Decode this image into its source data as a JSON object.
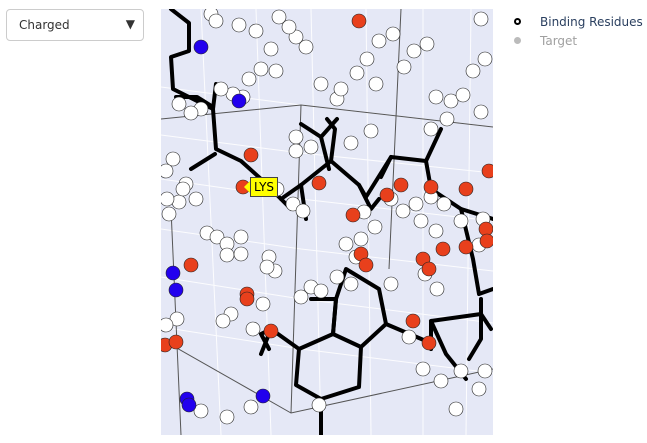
{
  "dropdown": {
    "selected": "Charged"
  },
  "legend": {
    "items": [
      {
        "label": "Binding Residues",
        "state": "visible"
      },
      {
        "label": "Target",
        "state": "hidden"
      }
    ]
  },
  "hover_label": {
    "text": "LYS"
  },
  "colors": {
    "plot_background": "#e5e8f6",
    "atom_white": "#ffffff",
    "atom_red": "#e8401c",
    "atom_blue": "#2200ee",
    "bond": "#000000",
    "hover_label_bg": "#ffff00",
    "legend_hidden": "#a0a0a0"
  }
}
